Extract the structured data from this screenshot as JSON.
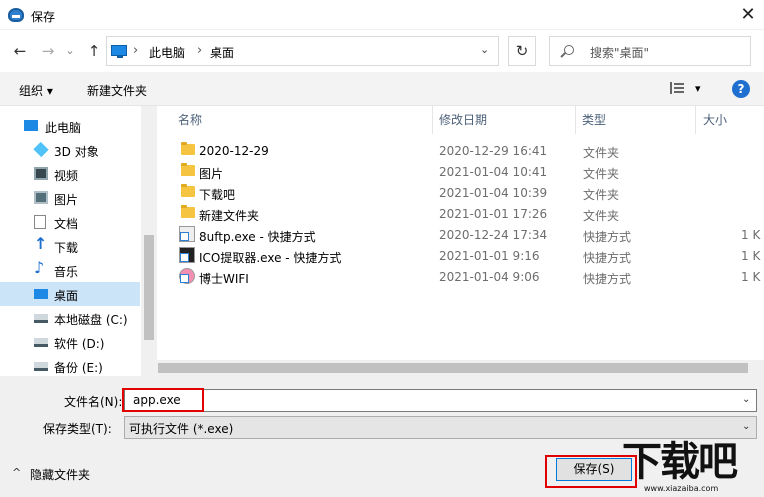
{
  "window": {
    "title": "保存",
    "close_glyph": "✕"
  },
  "nav": {
    "back": "←",
    "forward": "→",
    "history": "⌄",
    "up": "↑",
    "breadcrumb": [
      "此电脑",
      "桌面"
    ],
    "sep": "›",
    "refresh": "↻",
    "search_placeholder": "搜索\"桌面\""
  },
  "toolbar": {
    "organize": "组织 ▾",
    "new_folder": "新建文件夹",
    "view_drop": "▾",
    "help": "?"
  },
  "sidebar": {
    "items": [
      {
        "label": "此电脑",
        "icon": "pc-icon"
      },
      {
        "label": "3D 对象",
        "icon": "cube-icon"
      },
      {
        "label": "视频",
        "icon": "video-icon"
      },
      {
        "label": "图片",
        "icon": "picture-icon"
      },
      {
        "label": "文档",
        "icon": "document-icon"
      },
      {
        "label": "下载",
        "icon": "download-icon"
      },
      {
        "label": "音乐",
        "icon": "music-icon"
      },
      {
        "label": "桌面",
        "icon": "desktop-icon",
        "selected": true
      },
      {
        "label": "本地磁盘 (C:)",
        "icon": "drive-icon"
      },
      {
        "label": "软件 (D:)",
        "icon": "drive-icon"
      },
      {
        "label": "备份 (E:)",
        "icon": "drive-icon"
      }
    ]
  },
  "columns": {
    "name": "名称",
    "date": "修改日期",
    "type": "类型",
    "size": "大小",
    "sort": "^"
  },
  "files": [
    {
      "name": "2020-12-29",
      "date": "2020-12-29 16:41",
      "type": "文件夹",
      "size": "",
      "kind": "folder"
    },
    {
      "name": "图片",
      "date": "2021-01-04 10:41",
      "type": "文件夹",
      "size": "",
      "kind": "folder"
    },
    {
      "name": "下载吧",
      "date": "2021-01-04 10:39",
      "type": "文件夹",
      "size": "",
      "kind": "folder"
    },
    {
      "name": "新建文件夹",
      "date": "2021-01-01 17:26",
      "type": "文件夹",
      "size": "",
      "kind": "folder"
    },
    {
      "name": "8uftp.exe - 快捷方式",
      "date": "2020-12-24 17:34",
      "type": "快捷方式",
      "size": "1 K",
      "kind": "shortcut"
    },
    {
      "name": "ICO提取器.exe - 快捷方式",
      "date": "2021-01-01 9:16",
      "type": "快捷方式",
      "size": "1 K",
      "kind": "shortcut"
    },
    {
      "name": "博士WIFI",
      "date": "2021-01-04 9:06",
      "type": "快捷方式",
      "size": "1 K",
      "kind": "shortcut"
    }
  ],
  "form": {
    "filename_label": "文件名(N):",
    "filename_value": "app.exe",
    "filetype_label": "保存类型(T):",
    "filetype_value": "可执行文件 (*.exe)",
    "dropdown": "⌄"
  },
  "footer": {
    "hide_folders": "隐藏文件夹",
    "chevron": "^",
    "save": "保存(S)"
  },
  "watermark": {
    "text": "下载吧",
    "url": "www.xiazaiba.com"
  }
}
